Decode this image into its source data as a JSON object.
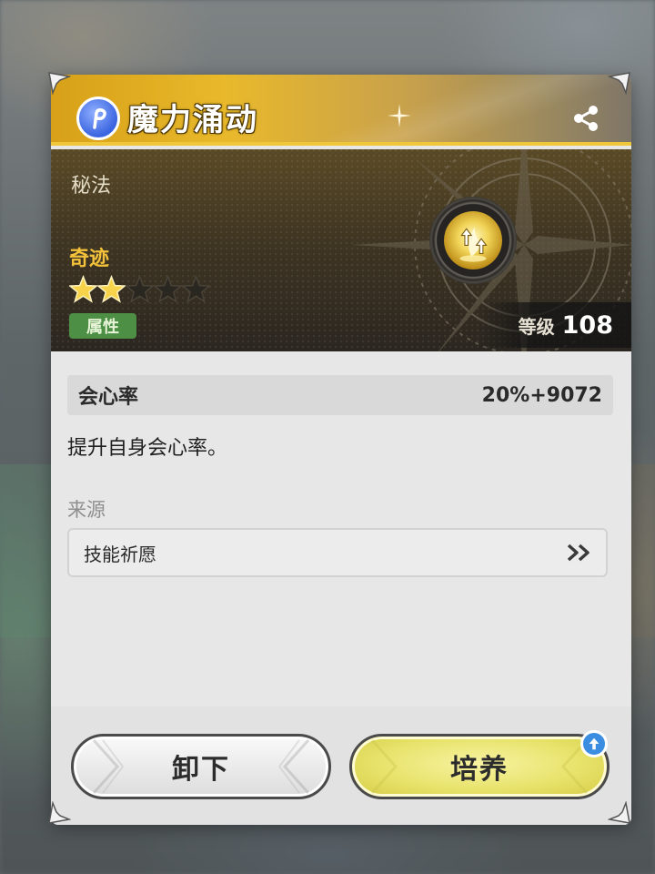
{
  "header": {
    "badge_icon": "rune-badge-icon",
    "title": "魔力涌动",
    "share_icon": "share-icon"
  },
  "info": {
    "type": "秘法",
    "rarity": "奇迹",
    "stars_filled": 2,
    "stars_total": 5,
    "tag": "属性",
    "level_label": "等级",
    "level_value": "108",
    "icon": "power-surge-icon"
  },
  "stat": {
    "name": "会心率",
    "value": "20%+9072"
  },
  "description": "提升自身会心率。",
  "source": {
    "label": "来源",
    "item": "技能祈愿",
    "arrow_icon": "double-chevron-right-icon"
  },
  "buttons": {
    "unequip": "卸下",
    "upgrade": "培养",
    "upgrade_badge_icon": "arrow-up-icon"
  },
  "colors": {
    "header_gold": "#e9b92b",
    "rarity_gold": "#f4c23a",
    "tag_green": "#4c8f45",
    "upgrade_yellow": "#e8e36c",
    "badge_blue": "#3a8de0"
  }
}
